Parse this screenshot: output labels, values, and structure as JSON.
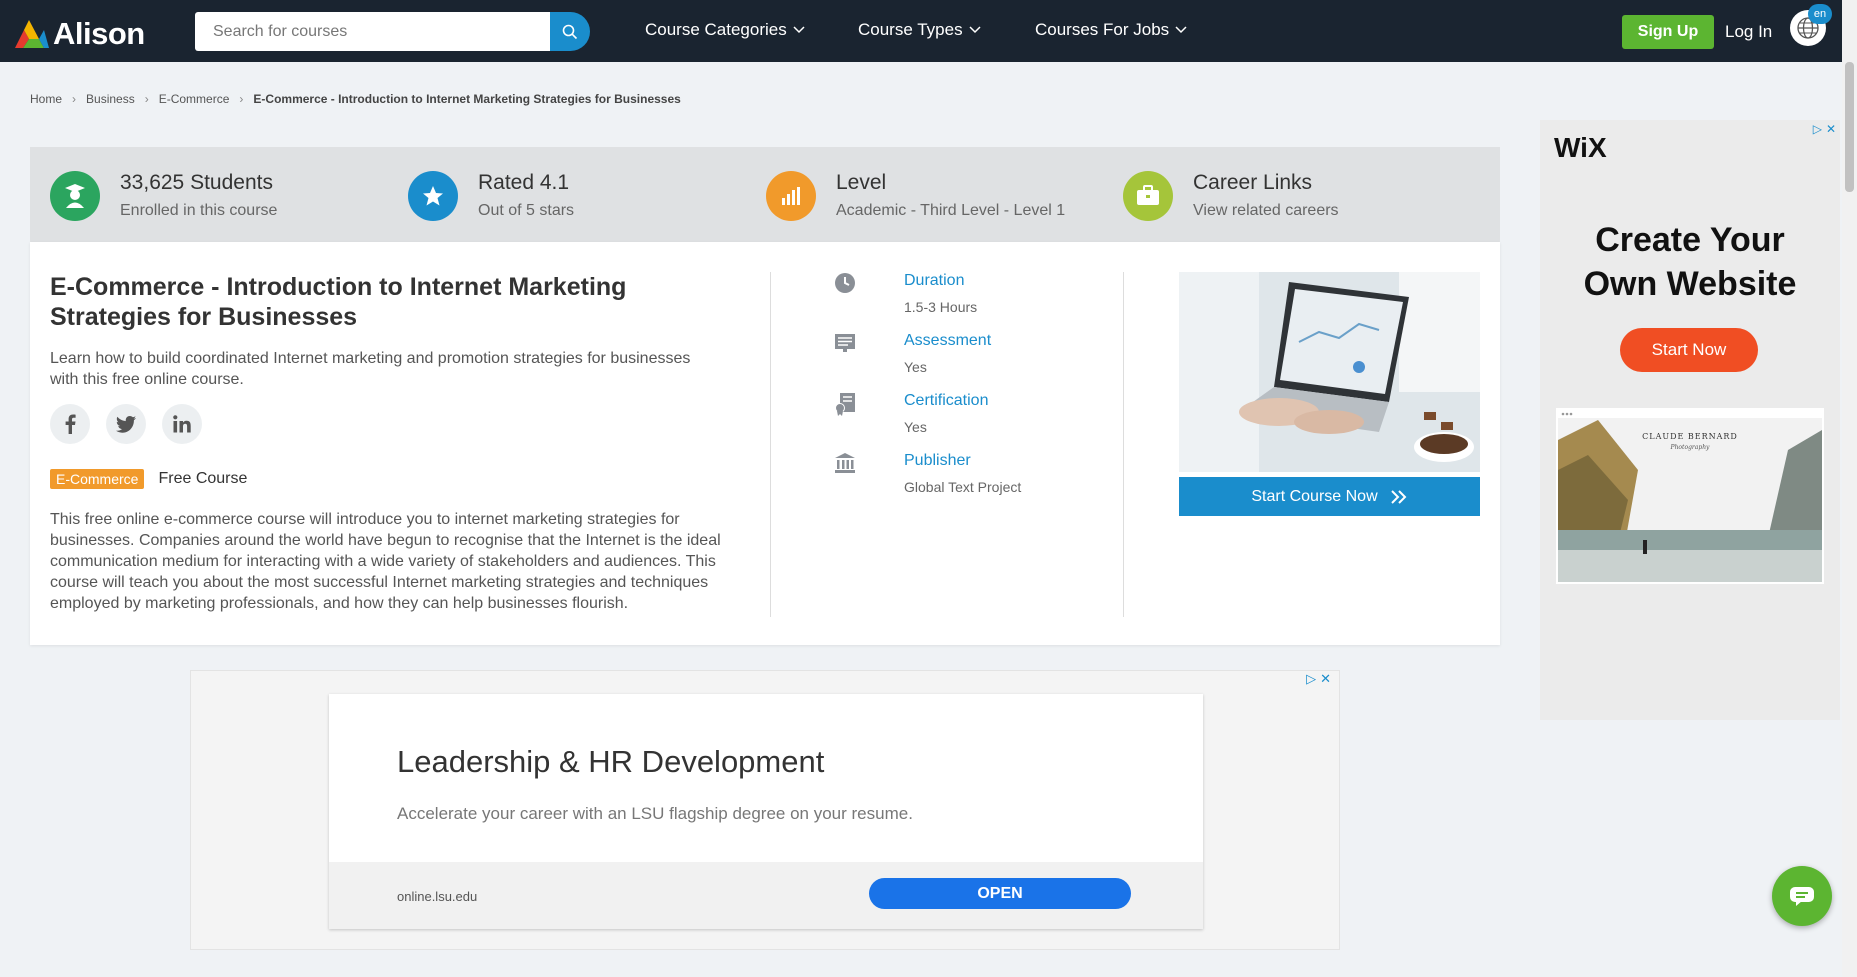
{
  "header": {
    "logo_text": "Alison",
    "search_placeholder": "Search for courses",
    "nav": [
      "Course Categories",
      "Course Types",
      "Courses For Jobs"
    ],
    "signup_label": "Sign Up",
    "login_label": "Log In",
    "lang_badge": "en"
  },
  "breadcrumb": [
    "Home",
    "Business",
    "E-Commerce",
    "E-Commerce - Introduction to Internet Marketing Strategies for Businesses"
  ],
  "stats": [
    {
      "title": "33,625 Students",
      "sub": "Enrolled in this course",
      "icon": "student-icon",
      "color": "#2ba55f"
    },
    {
      "title": "Rated 4.1",
      "sub": "Out of 5 stars",
      "icon": "star-icon",
      "color": "#1a8dcc"
    },
    {
      "title": "Level",
      "sub": "Academic - Third Level - Level 1",
      "icon": "level-chart-icon",
      "color": "#f19a2b"
    },
    {
      "title": "Career Links",
      "sub": "View related careers",
      "icon": "briefcase-icon",
      "color": "#a5c53a"
    }
  ],
  "course": {
    "title": "E-Commerce - Introduction to Internet Marketing Strategies for Businesses",
    "lead": "Learn how to build coordinated Internet marketing and promotion strategies for businesses with this free online course.",
    "tag": "E-Commerce",
    "free_label": "Free Course",
    "description": "This free online e-commerce course will introduce you to internet marketing strategies for businesses. Companies around the world have begun to recognise that the Internet is the ideal communication medium for interacting with a wide variety of stakeholders and audiences. This course will teach you about the most successful Internet marketing strategies and techniques employed by marketing professionals, and how they can help businesses flourish.",
    "start_label": "Start Course Now"
  },
  "details": [
    {
      "label": "Duration",
      "value": "1.5-3 Hours",
      "icon": "clock-icon"
    },
    {
      "label": "Assessment",
      "value": "Yes",
      "icon": "assessment-icon"
    },
    {
      "label": "Certification",
      "value": "Yes",
      "icon": "certificate-icon"
    },
    {
      "label": "Publisher",
      "value": "Global Text Project",
      "icon": "bank-icon"
    }
  ],
  "side_ad": {
    "brand": "WiX",
    "headline_line1": "Create Your",
    "headline_line2": "Own Website",
    "cta": "Start Now",
    "preview_title": "CLAUDE BERNARD",
    "preview_sub": "Photography"
  },
  "bottom_ad": {
    "title": "Leadership & HR Development",
    "subtitle": "Accelerate your career with an LSU flagship degree on your resume.",
    "url": "online.lsu.edu",
    "cta": "OPEN"
  }
}
